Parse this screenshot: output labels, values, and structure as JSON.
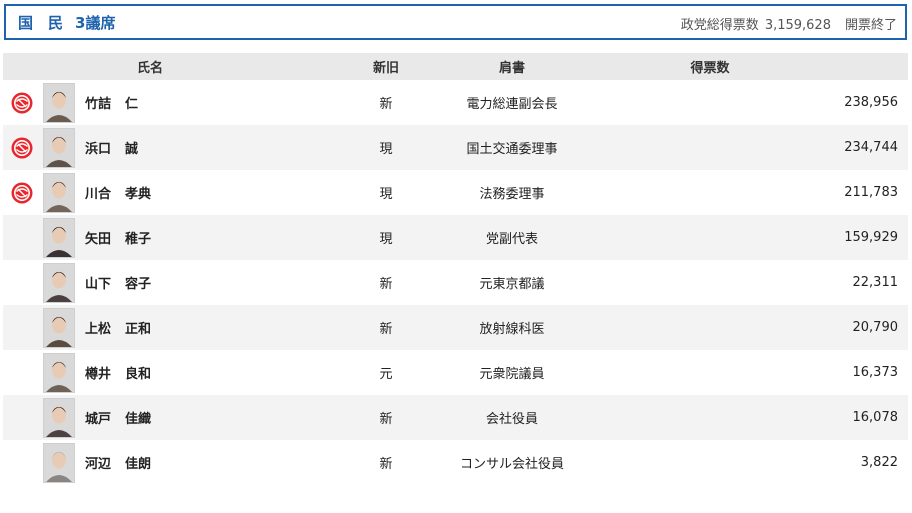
{
  "header": {
    "party": "国　民",
    "seats": "3議席",
    "votes_label": "政党総得票数",
    "votes_value": "3,159,628",
    "status": "開票終了"
  },
  "columns": {
    "name": "氏名",
    "status": "新旧",
    "title": "肩書",
    "votes": "得票数"
  },
  "colors": {
    "accent": "#1f63ad",
    "win_mark": "#e8262b",
    "header_row_bg": "#e9e9e9",
    "stripe_bg": "#f3f3f3"
  },
  "candidates": [
    {
      "elected": true,
      "family": "竹詰",
      "given": "仁",
      "status": "新",
      "title": "電力総連副会長",
      "votes": "238,956"
    },
    {
      "elected": true,
      "family": "浜口",
      "given": "誠",
      "status": "現",
      "title": "国土交通委理事",
      "votes": "234,744"
    },
    {
      "elected": true,
      "family": "川合",
      "given": "孝典",
      "status": "現",
      "title": "法務委理事",
      "votes": "211,783"
    },
    {
      "elected": false,
      "family": "矢田",
      "given": "稚子",
      "status": "現",
      "title": "党副代表",
      "votes": "159,929"
    },
    {
      "elected": false,
      "family": "山下",
      "given": "容子",
      "status": "新",
      "title": "元東京都議",
      "votes": "22,311"
    },
    {
      "elected": false,
      "family": "上松",
      "given": "正和",
      "status": "新",
      "title": "放射線科医",
      "votes": "20,790"
    },
    {
      "elected": false,
      "family": "樽井",
      "given": "良和",
      "status": "元",
      "title": "元衆院議員",
      "votes": "16,373"
    },
    {
      "elected": false,
      "family": "城戸",
      "given": "佳織",
      "status": "新",
      "title": "会社役員",
      "votes": "16,078"
    },
    {
      "elected": false,
      "family": "河辺",
      "given": "佳朗",
      "status": "新",
      "title": "コンサル会社役員",
      "votes": "3,822"
    }
  ]
}
